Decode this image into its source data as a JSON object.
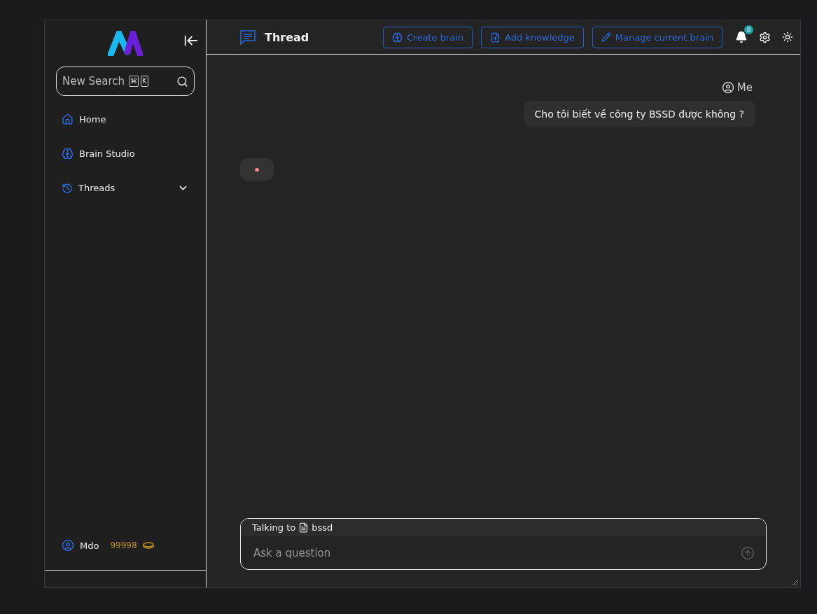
{
  "sidebar": {
    "search": {
      "placeholder": "New Search",
      "shortcut": [
        "⌘",
        "K"
      ]
    },
    "items": [
      {
        "kind": "home",
        "label": "Home"
      },
      {
        "kind": "studio",
        "label": "Brain Studio"
      },
      {
        "kind": "threads",
        "label": "Threads",
        "expanded": false
      }
    ],
    "user": {
      "name": "Mdo",
      "credits": "99998"
    }
  },
  "header": {
    "title": "Thread",
    "buttons": [
      {
        "kind": "brain",
        "label": "Create brain"
      },
      {
        "kind": "upload",
        "label": "Add knowledge"
      },
      {
        "kind": "edit",
        "label": "Manage current brain"
      }
    ],
    "notifications": "0"
  },
  "messages": [
    {
      "kind": "user",
      "author": "Me",
      "text": "Cho tôi biết về công ty BSSD được không ?"
    },
    {
      "kind": "loading"
    }
  ],
  "composer": {
    "talking_label": "Talking to",
    "brain": "bssd",
    "placeholder": "Ask a question"
  }
}
